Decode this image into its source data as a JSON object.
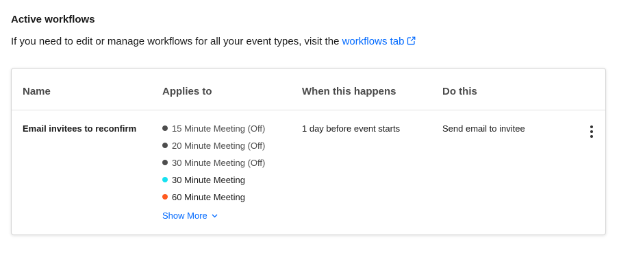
{
  "section": {
    "title": "Active workflows",
    "intro_text": "If you need to edit or manage workflows for all your event types, visit the",
    "link_text": "workflows tab",
    "link_icon": "external-link-icon"
  },
  "table": {
    "headers": {
      "name": "Name",
      "applies_to": "Applies to",
      "when": "When this happens",
      "action": "Do this"
    },
    "row": {
      "name": "Email invitees to reconfirm",
      "applies_to": [
        {
          "label": "15 Minute Meeting (Off)",
          "color": "#4d4d4d",
          "off": true
        },
        {
          "label": "20 Minute Meeting (Off)",
          "color": "#4d4d4d",
          "off": true
        },
        {
          "label": "30 Minute Meeting (Off)",
          "color": "#4d4d4d",
          "off": true
        },
        {
          "label": "30 Minute Meeting",
          "color": "#17e1f0",
          "off": false
        },
        {
          "label": "60 Minute Meeting",
          "color": "#ff5a1f",
          "off": false
        }
      ],
      "show_more": "Show More",
      "when": "1 day before event starts",
      "action": "Send email to invitee",
      "menu_icon": "kebab-menu-icon"
    }
  },
  "colors": {
    "link": "#0069ff",
    "text": "#1a1a1a"
  }
}
